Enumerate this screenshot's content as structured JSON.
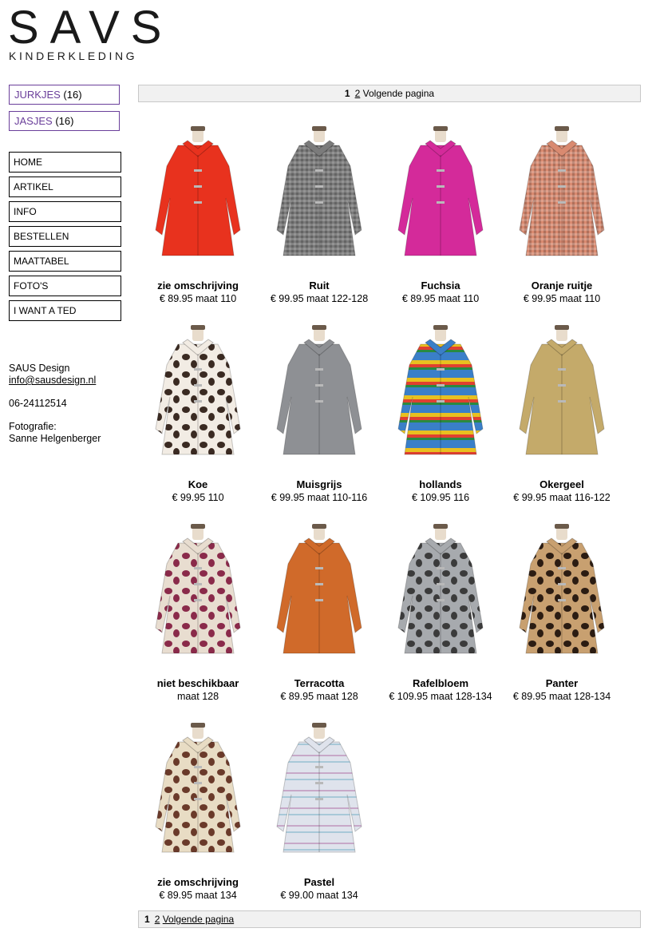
{
  "logo": {
    "main": "SAVS",
    "sub": "KINDERKLEDING"
  },
  "categories": [
    {
      "label": "JURKJES",
      "count": "(16)"
    },
    {
      "label": "JASJES",
      "count": "(16)"
    }
  ],
  "nav": [
    "HOME",
    "ARTIKEL",
    "INFO",
    "BESTELLEN",
    "MAATTABEL",
    "FOTO'S",
    "I WANT A TED"
  ],
  "contact": {
    "name": "SAUS Design",
    "email": "info@sausdesign.nl",
    "phone": "06-24112514",
    "photo_label": "Fotografie:",
    "photographer": "Sanne Helgenberger"
  },
  "pager": {
    "current": "1",
    "page2": "2",
    "next": "Volgende pagina"
  },
  "products": [
    {
      "name": "zie omschrijving",
      "price": "€ 89.95  maat 110",
      "color": "#e8321e",
      "pattern": "solid"
    },
    {
      "name": "Ruit",
      "price": "€ 99.95  maat 122-128",
      "color": "#7b7b7b",
      "pattern": "check"
    },
    {
      "name": "Fuchsia",
      "price": "€ 89.95  maat 110",
      "color": "#d42a9a",
      "pattern": "solid"
    },
    {
      "name": "Oranje ruitje",
      "price": "€ 99.95  maat 110",
      "color": "#d98a70",
      "pattern": "check"
    },
    {
      "name": "Koe",
      "price": "€ 99.95  110",
      "color": "#f2ece4",
      "pattern": "cow"
    },
    {
      "name": "Muisgrijs",
      "price": "€ 99.95  maat 110-116",
      "color": "#8e9094",
      "pattern": "solid"
    },
    {
      "name": "hollands",
      "price": "€ 109.95  116",
      "color": "#3a7fc8",
      "pattern": "tulip"
    },
    {
      "name": "Okergeel",
      "price": "€ 99.95  maat 116-122",
      "color": "#c4aa6a",
      "pattern": "solid"
    },
    {
      "name": "niet beschikbaar",
      "price": "maat 128",
      "color": "#e8ddd0",
      "pattern": "swirl"
    },
    {
      "name": "Terracotta",
      "price": "€ 89.95  maat 128",
      "color": "#d06a2a",
      "pattern": "solid"
    },
    {
      "name": "Rafelbloem",
      "price": "€ 109.95  maat 128-134",
      "color": "#a7aaae",
      "pattern": "flower"
    },
    {
      "name": "Panter",
      "price": "€ 89.95  maat 128-134",
      "color": "#c8a070",
      "pattern": "leopard"
    },
    {
      "name": "zie omschrijving",
      "price": "€ 89.95  maat 134",
      "color": "#e8dcc4",
      "pattern": "damask"
    },
    {
      "name": "Pastel",
      "price": "€ 99.00  maat 134",
      "color": "#dfe3ec",
      "pattern": "pastel"
    }
  ]
}
